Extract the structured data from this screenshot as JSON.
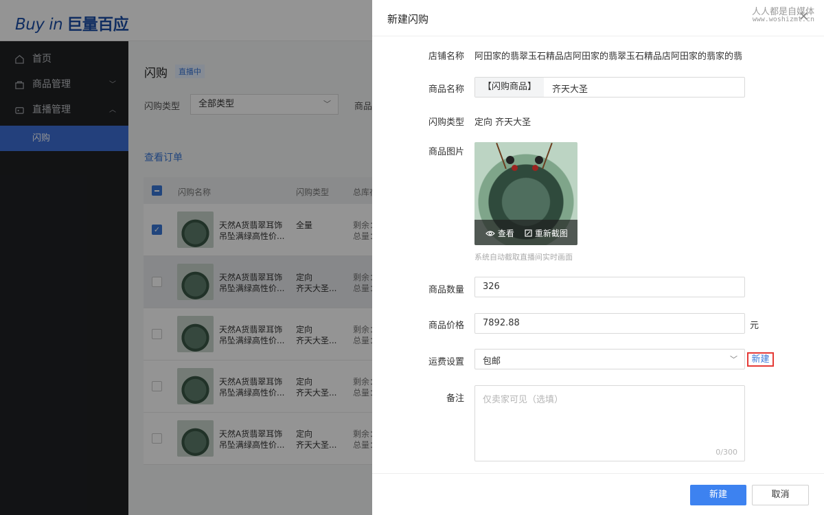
{
  "app": {
    "logo_en": "Buy in",
    "logo_cn": "巨量百应"
  },
  "sidebar": {
    "items": [
      {
        "label": "首页",
        "icon": "home-icon"
      },
      {
        "label": "商品管理",
        "icon": "bag-icon"
      },
      {
        "label": "直播管理",
        "icon": "camera-icon"
      }
    ],
    "sub_item": "闪购"
  },
  "page": {
    "title": "闪购",
    "status_badge": "直播中",
    "filter_type_label": "闪购类型",
    "filter_type_value": "全部类型",
    "filter_product_label": "商品",
    "view_orders": "查看订单"
  },
  "table": {
    "headers": [
      "闪购名称",
      "闪购类型",
      "总库存"
    ],
    "rows": [
      {
        "name1": "天然A货翡翠耳饰",
        "name2": "吊坠满绿高性价...",
        "type1": "全量",
        "type2": "",
        "stock1": "剩余：",
        "stock2": "总量：",
        "checked": true
      },
      {
        "name1": "天然A货翡翠耳饰",
        "name2": "吊坠满绿高性价...",
        "type1": "定向",
        "type2": "齐天大圣...",
        "stock1": "剩余：",
        "stock2": "总量：",
        "checked": false
      },
      {
        "name1": "天然A货翡翠耳饰",
        "name2": "吊坠满绿高性价...",
        "type1": "定向",
        "type2": "齐天大圣...",
        "stock1": "剩余：",
        "stock2": "总量：",
        "checked": false
      },
      {
        "name1": "天然A货翡翠耳饰",
        "name2": "吊坠满绿高性价...",
        "type1": "定向",
        "type2": "齐天大圣...",
        "stock1": "剩余：",
        "stock2": "总量：",
        "checked": false
      },
      {
        "name1": "天然A货翡翠耳饰",
        "name2": "吊坠满绿高性价...",
        "type1": "定向",
        "type2": "齐天大圣...",
        "stock1": "剩余：",
        "stock2": "总量：",
        "checked": false
      }
    ]
  },
  "drawer": {
    "title": "新建闪购",
    "watermark_line1": "人人都是自媒体",
    "watermark_line2": "www.woshizmt.cn",
    "shop_label": "店铺名称",
    "shop_value": "阿田家的翡翠玉石精品店阿田家的翡翠玉石精品店阿田家的翡家的翡",
    "product_label": "商品名称",
    "product_prefix": "【闪购商品】",
    "product_value": "齐天大圣",
    "type_label": "闪购类型",
    "type_value": "定向 齐天大圣",
    "image_label": "商品图片",
    "image_view": "查看",
    "image_recrop": "重新截图",
    "image_hint": "系统自动截取直播间实时画面",
    "qty_label": "商品数量",
    "qty_value": "326",
    "price_label": "商品价格",
    "price_value": "7892.88",
    "price_unit": "元",
    "shipping_label": "运费设置",
    "shipping_value": "包邮",
    "shipping_new": "新建",
    "note_label": "备注",
    "note_placeholder": "仅卖家可见（选填）",
    "note_count": "0/300",
    "submit": "新建",
    "cancel": "取消"
  }
}
